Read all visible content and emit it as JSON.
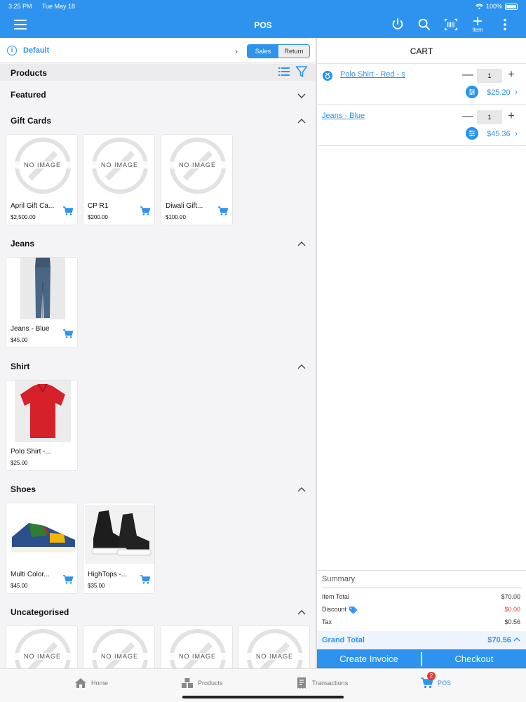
{
  "status": {
    "time": "3:25 PM",
    "date": "Tue May 18",
    "battery": "100%"
  },
  "header": {
    "title": "POS",
    "item_label": "Item"
  },
  "toolbar": {
    "default_label": "Default",
    "sales_label": "Sales",
    "return_label": "Return"
  },
  "products": {
    "label": "Products"
  },
  "no_image_text": "NO IMAGE",
  "sections": [
    {
      "title": "Featured",
      "expanded": false,
      "items": []
    },
    {
      "title": "Gift Cards",
      "expanded": true,
      "items": [
        {
          "name": "April Gift Ca...",
          "price": "$2,500.00",
          "image": "no-image"
        },
        {
          "name": "CP R1",
          "price": "$200.00",
          "image": "no-image"
        },
        {
          "name": "Diwali Gift...",
          "price": "$100.00",
          "image": "no-image"
        }
      ]
    },
    {
      "title": "Jeans",
      "expanded": true,
      "items": [
        {
          "name": "Jeans - Blue",
          "price": "$45.00",
          "image": "jeans-photo"
        }
      ]
    },
    {
      "title": "Shirt",
      "expanded": true,
      "items": [
        {
          "name": "Polo Shirt -...",
          "price": "$25.00",
          "image": "polo-photo"
        }
      ]
    },
    {
      "title": "Shoes",
      "expanded": true,
      "items": [
        {
          "name": "Multi Color...",
          "price": "$45.00",
          "image": "multicolor-shoe-photo"
        },
        {
          "name": "HighTops -...",
          "price": "$35.00",
          "image": "hightops-photo"
        }
      ]
    },
    {
      "title": "Uncategorised",
      "expanded": true,
      "items": [
        {
          "image": "no-image"
        },
        {
          "image": "no-image"
        },
        {
          "image": "no-image"
        },
        {
          "image": "no-image"
        }
      ]
    }
  ],
  "cart": {
    "title": "CART",
    "lines": [
      {
        "name": "Polo Shirt - Red - s",
        "qty": "1",
        "price": "$25.20",
        "has_badge": true
      },
      {
        "name": "Jeans - Blue",
        "qty": "1",
        "price": "$45.36",
        "has_badge": false
      }
    ],
    "summary": {
      "title": "Summary",
      "item_total_label": "Item Total",
      "item_total": "$70.00",
      "discount_label": "Discount",
      "discount": "$0.00",
      "tax_label": "Tax",
      "tax": "$0.56",
      "grand_total_label": "Grand Total",
      "grand_total": "$70.56"
    },
    "create_invoice_label": "Create Invoice",
    "checkout_label": "Checkout"
  },
  "tabs": [
    {
      "label": "Home",
      "icon": "home-icon"
    },
    {
      "label": "Products",
      "icon": "boxes-icon"
    },
    {
      "label": "Transactions",
      "icon": "receipt-icon"
    },
    {
      "label": "POS",
      "icon": "cart-icon",
      "badge": "2",
      "active": true
    }
  ],
  "colors": {
    "accent": "#2e93ee",
    "discount": "#e53935"
  }
}
